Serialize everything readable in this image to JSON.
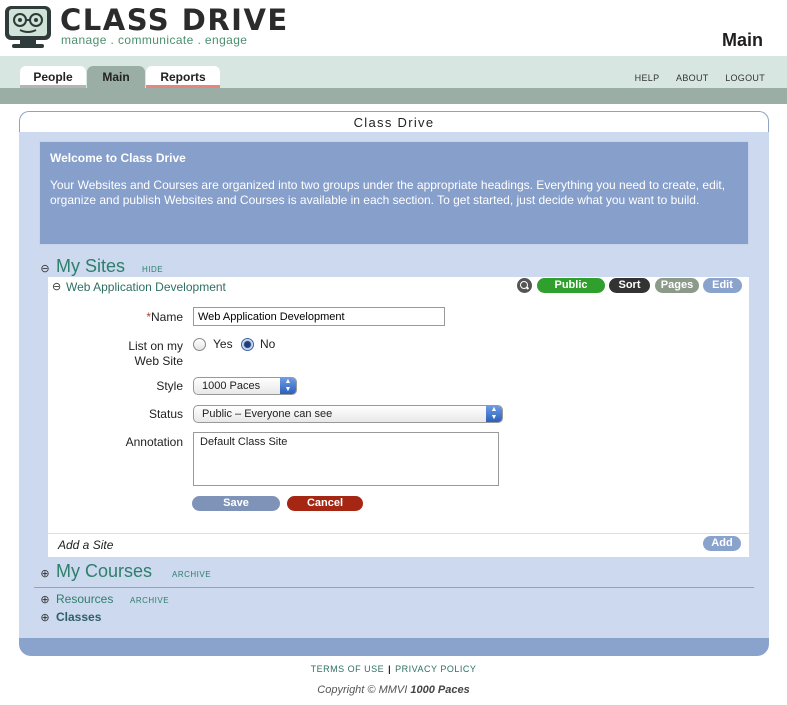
{
  "brand": {
    "title": "CLASS DRIVE",
    "tagline": "manage . communicate . engage"
  },
  "page_heading": "Main",
  "tabs": [
    {
      "label": "People"
    },
    {
      "label": "Main"
    },
    {
      "label": "Reports"
    }
  ],
  "top_links": [
    "HELP",
    "ABOUT",
    "LOGOUT"
  ],
  "panel_title": "Class Drive",
  "welcome": {
    "title": "Welcome to Class Drive",
    "text": "Your Websites and Courses are organized into two groups under the appropriate headings. Everything you need to create, edit, organize and publish Websites and Courses is available in each section. To get started, just decide what you want to build."
  },
  "my_sites": {
    "toggle": "⊖",
    "title": "My Sites",
    "action": "HIDE",
    "site": {
      "toggle": "⊖",
      "title": "Web Application Development",
      "actions": {
        "public": "Public",
        "sort": "Sort",
        "pages": "Pages",
        "edit": "Edit"
      },
      "form": {
        "name_required": "*",
        "name_label": "Name",
        "name_value": "Web Application Development",
        "list_label_1": "List on my",
        "list_label_2": "Web Site",
        "yes_label": "Yes",
        "no_label": "No",
        "list_selected": "No",
        "style_label": "Style",
        "style_value": "1000 Paces",
        "status_label": "Status",
        "status_value": "Public – Everyone can see",
        "annotation_label": "Annotation",
        "annotation_value": "Default Class Site",
        "save": "Save",
        "cancel": "Cancel"
      }
    },
    "add_site": "Add a Site",
    "add_button": "Add"
  },
  "my_courses": {
    "toggle": "⊕",
    "title": "My Courses",
    "action": "ARCHIVE"
  },
  "resources": {
    "toggle": "⊕",
    "title": "Resources",
    "action": "ARCHIVE"
  },
  "classes": {
    "toggle": "⊕",
    "title": "Classes"
  },
  "footer": {
    "terms": "TERMS OF USE",
    "separator": "|",
    "privacy": "PRIVACY POLICY",
    "copyright_prefix": "Copyright © MMVI",
    "copyright_brand": "1000 Paces"
  },
  "colors": {
    "panel": "#ccd9ef",
    "welcome": "#879fcb",
    "accent_green": "#2e7f6a",
    "public": "#2fa02e",
    "sort": "#333333",
    "pages": "#8c9a8a",
    "edit": "#8aa3cd",
    "save": "#7f93b8",
    "cancel": "#a52613"
  }
}
